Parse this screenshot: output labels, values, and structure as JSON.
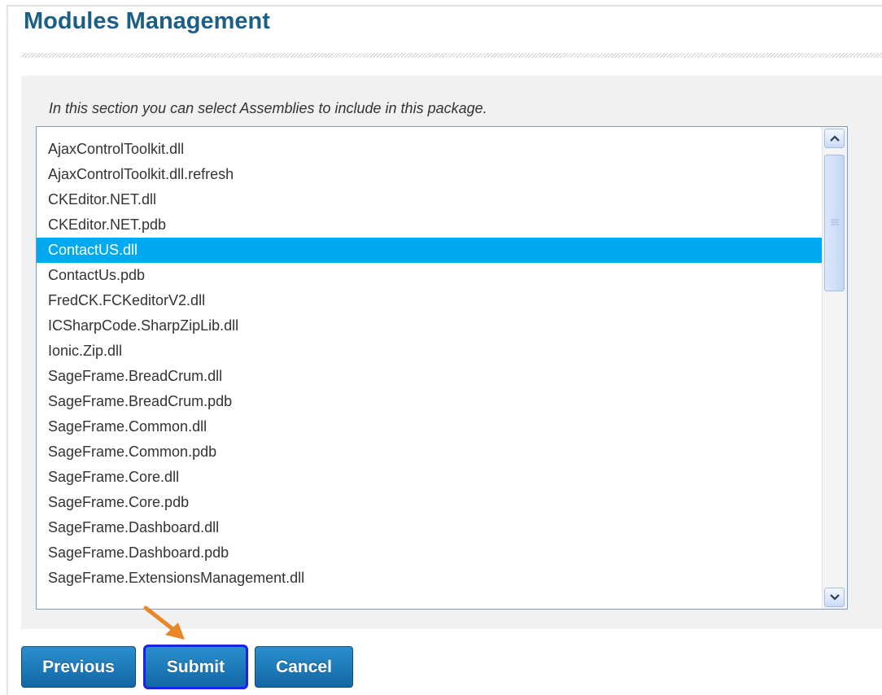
{
  "page": {
    "title": "Modules Management",
    "instructions": "In this section you can select Assemblies to include in this package."
  },
  "assemblies": {
    "items": [
      "AjaxControlToolkit.dll",
      "AjaxControlToolkit.dll.refresh",
      "CKEditor.NET.dll",
      "CKEditor.NET.pdb",
      "ContactUS.dll",
      "ContactUs.pdb",
      "FredCK.FCKeditorV2.dll",
      "ICSharpCode.SharpZipLib.dll",
      "Ionic.Zip.dll",
      "SageFrame.BreadCrum.dll",
      "SageFrame.BreadCrum.pdb",
      "SageFrame.Common.dll",
      "SageFrame.Common.pdb",
      "SageFrame.Core.dll",
      "SageFrame.Core.pdb",
      "SageFrame.Dashboard.dll",
      "SageFrame.Dashboard.pdb",
      "SageFrame.ExtensionsManagement.dll"
    ],
    "selected": "ContactUS.dll"
  },
  "buttons": {
    "previous": "Previous",
    "submit": "Submit",
    "cancel": "Cancel"
  },
  "colors": {
    "title": "#1c5f86",
    "selection": "#00a9f0",
    "button": "#1a74b4",
    "annotation_arrow": "#e8862a",
    "focus_outline": "#1c22e8"
  },
  "icons": {
    "scroll_up": "chevron-up-icon",
    "scroll_down": "chevron-down-icon",
    "annotation": "orange-arrow-icon"
  }
}
